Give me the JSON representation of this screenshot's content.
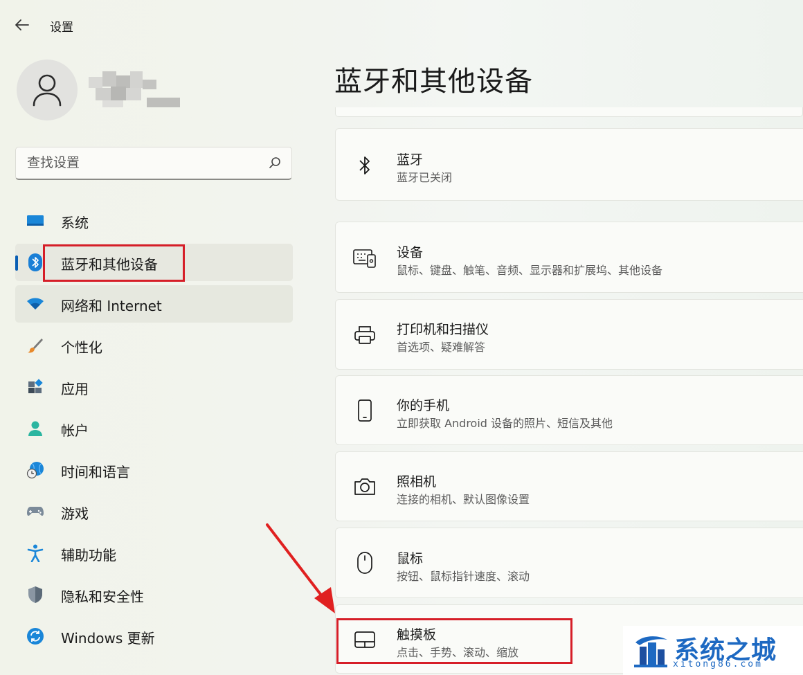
{
  "window": {
    "title": "设置"
  },
  "search": {
    "placeholder": "查找设置"
  },
  "sidebar": {
    "items": [
      {
        "label": "系统",
        "icon": "monitor-icon"
      },
      {
        "label": "蓝牙和其他设备",
        "icon": "bluetooth-icon"
      },
      {
        "label": "网络和 Internet",
        "icon": "wifi-icon"
      },
      {
        "label": "个性化",
        "icon": "brush-icon"
      },
      {
        "label": "应用",
        "icon": "apps-icon"
      },
      {
        "label": "帐户",
        "icon": "account-icon"
      },
      {
        "label": "时间和语言",
        "icon": "globe-clock-icon"
      },
      {
        "label": "游戏",
        "icon": "gamepad-icon"
      },
      {
        "label": "辅助功能",
        "icon": "accessibility-icon"
      },
      {
        "label": "隐私和安全性",
        "icon": "shield-icon"
      },
      {
        "label": "Windows 更新",
        "icon": "update-icon"
      }
    ],
    "selected": "蓝牙和其他设备"
  },
  "main": {
    "title": "蓝牙和其他设备",
    "cards": [
      {
        "title": "蓝牙",
        "subtitle": "蓝牙已关闭",
        "icon": "bluetooth-icon"
      },
      {
        "title": "设备",
        "subtitle": "鼠标、键盘、触笔、音频、显示器和扩展坞、其他设备",
        "icon": "devices-icon"
      },
      {
        "title": "打印机和扫描仪",
        "subtitle": "首选项、疑难解答",
        "icon": "printer-icon"
      },
      {
        "title": "你的手机",
        "subtitle": "立即获取 Android 设备的照片、短信及其他",
        "icon": "phone-icon"
      },
      {
        "title": "照相机",
        "subtitle": "连接的相机、默认图像设置",
        "icon": "camera-icon"
      },
      {
        "title": "鼠标",
        "subtitle": "按钮、鼠标指针速度、滚动",
        "icon": "mouse-icon"
      },
      {
        "title": "触摸板",
        "subtitle": "点击、手势、滚动、缩放",
        "icon": "touchpad-icon"
      }
    ]
  },
  "watermark": {
    "text": "系统之城",
    "sub": "xitong86.com"
  },
  "colors": {
    "accent": "#0a5fb4",
    "highlight": "#d61e28",
    "watermark": "#1d69c2"
  }
}
